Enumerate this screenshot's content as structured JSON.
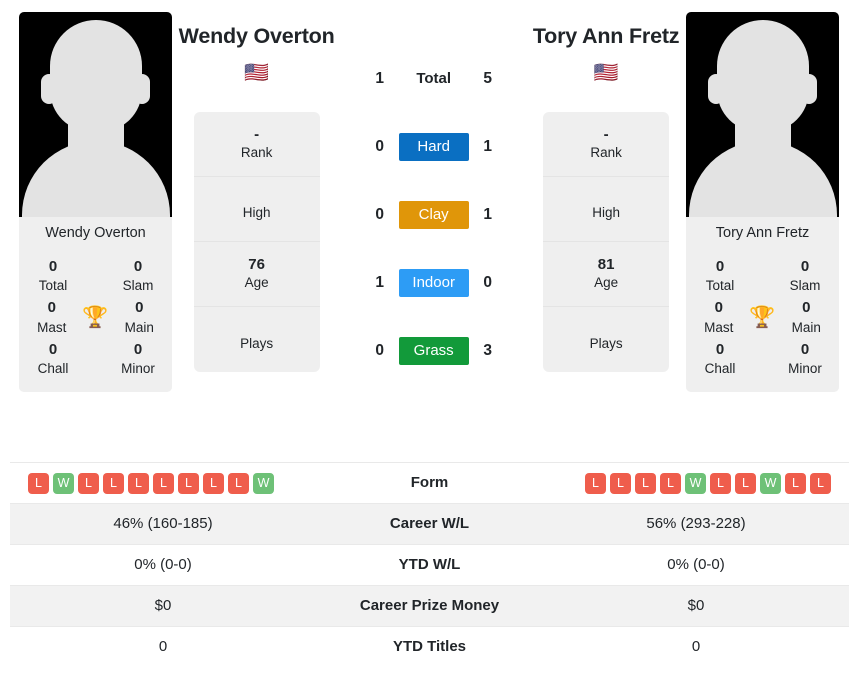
{
  "colors": {
    "hard": "#0a6fc2",
    "clay": "#e09609",
    "indoor": "#2d9cf5",
    "grass": "#129a3a",
    "win": "#6ec177",
    "loss": "#ef5d4c",
    "trophy": "#3a6fb5",
    "panel_bg": "#efefef",
    "row_alt_bg": "#f2f2f2"
  },
  "left_player": {
    "name": "Wendy Overton",
    "photo_caption": "Wendy Overton",
    "flag": "🇺🇸",
    "flag_name": "united-states-flag",
    "titles": [
      {
        "value": "0",
        "label": "Total"
      },
      {
        "value": "0",
        "label": "Slam"
      },
      {
        "value": "0",
        "label": "Mast"
      },
      {
        "value": "0",
        "label": "Main"
      },
      {
        "value": "0",
        "label": "Chall"
      },
      {
        "value": "0",
        "label": "Minor"
      }
    ],
    "info": [
      {
        "value": "-",
        "label": "Rank"
      },
      {
        "value": "",
        "label": "High"
      },
      {
        "value": "76",
        "label": "Age"
      },
      {
        "value": "",
        "label": "Plays"
      }
    ],
    "form": [
      "L",
      "W",
      "L",
      "L",
      "L",
      "L",
      "L",
      "L",
      "L",
      "W"
    ],
    "career_wl": "46% (160-185)",
    "ytd_wl": "0% (0-0)",
    "career_prize_money": "$0",
    "ytd_titles": "0"
  },
  "right_player": {
    "name": "Tory Ann Fretz",
    "photo_caption": "Tory Ann Fretz",
    "flag": "🇺🇸",
    "flag_name": "united-states-flag",
    "titles": [
      {
        "value": "0",
        "label": "Total"
      },
      {
        "value": "0",
        "label": "Slam"
      },
      {
        "value": "0",
        "label": "Mast"
      },
      {
        "value": "0",
        "label": "Main"
      },
      {
        "value": "0",
        "label": "Chall"
      },
      {
        "value": "0",
        "label": "Minor"
      }
    ],
    "info": [
      {
        "value": "-",
        "label": "Rank"
      },
      {
        "value": "",
        "label": "High"
      },
      {
        "value": "81",
        "label": "Age"
      },
      {
        "value": "",
        "label": "Plays"
      }
    ],
    "form": [
      "L",
      "L",
      "L",
      "L",
      "W",
      "L",
      "L",
      "W",
      "L",
      "L"
    ],
    "career_wl": "56% (293-228)",
    "ytd_wl": "0% (0-0)",
    "career_prize_money": "$0",
    "ytd_titles": "0"
  },
  "head_to_head": [
    {
      "left": "1",
      "label": "Total",
      "right": "5",
      "style": "plain"
    },
    {
      "left": "0",
      "label": "Hard",
      "right": "1",
      "style": "hard"
    },
    {
      "left": "0",
      "label": "Clay",
      "right": "1",
      "style": "clay"
    },
    {
      "left": "1",
      "label": "Indoor",
      "right": "0",
      "style": "indoor"
    },
    {
      "left": "0",
      "label": "Grass",
      "right": "3",
      "style": "grass"
    }
  ],
  "table_rows": [
    {
      "label": "Form",
      "type": "form"
    },
    {
      "label": "Career W/L",
      "type": "text",
      "left": "46% (160-185)",
      "right": "56% (293-228)"
    },
    {
      "label": "YTD W/L",
      "type": "text",
      "left": "0% (0-0)",
      "right": "0% (0-0)"
    },
    {
      "label": "Career Prize Money",
      "type": "text",
      "left": "$0",
      "right": "$0"
    },
    {
      "label": "YTD Titles",
      "type": "text",
      "left": "0",
      "right": "0"
    }
  ]
}
